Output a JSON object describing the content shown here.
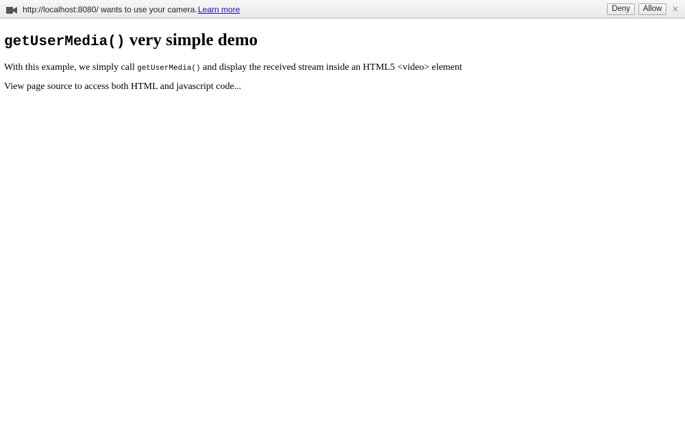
{
  "infobar": {
    "camera_icon": "video-camera-icon",
    "message": "http://localhost:8080/ wants to use your camera.",
    "learn_more_label": "Learn more",
    "deny_label": "Deny",
    "allow_label": "Allow",
    "close_glyph": "×"
  },
  "page": {
    "title_code": "getUserMedia()",
    "title_rest": " very simple demo",
    "paragraph1": {
      "before": "With this example, we simply call ",
      "code": "getUserMedia()",
      "after": " and display the received stream inside an HTML5 <video> element"
    },
    "paragraph2": "View page source to access both HTML and javascript code..."
  },
  "colors": {
    "link": "#1a0dab",
    "infobar_bg": "#eeeeee",
    "text": "#000000"
  }
}
